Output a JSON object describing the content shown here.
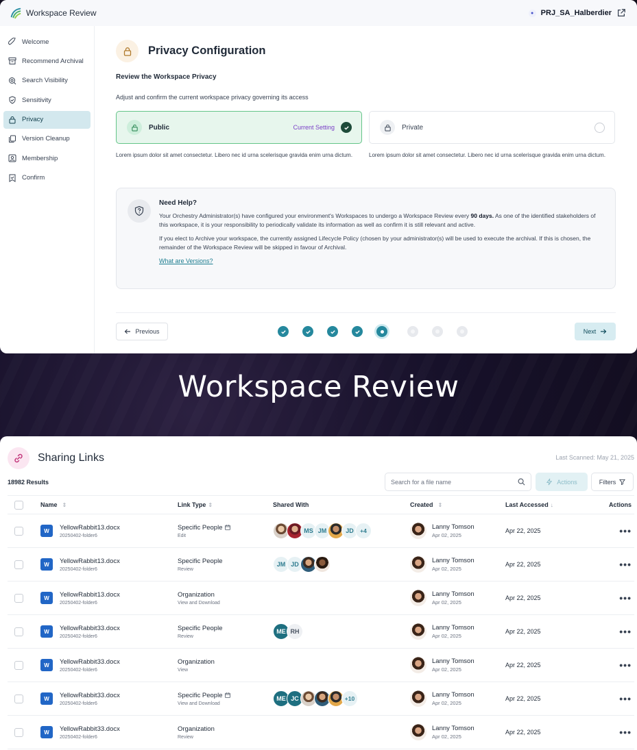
{
  "top": {
    "app_title": "Workspace Review",
    "project_name": "PRJ_SA_Halberdier",
    "sidebar": [
      {
        "label": "Welcome",
        "icon": "rocket-icon"
      },
      {
        "label": "Recommend Archival",
        "icon": "archive-icon"
      },
      {
        "label": "Search Visibility",
        "icon": "search-icon"
      },
      {
        "label": "Sensitivity",
        "icon": "shield-icon"
      },
      {
        "label": "Privacy",
        "icon": "lock-icon",
        "active": true
      },
      {
        "label": "Version Cleanup",
        "icon": "copy-icon"
      },
      {
        "label": "Membership",
        "icon": "user-icon"
      },
      {
        "label": "Confirm",
        "icon": "bookmark-check-icon"
      }
    ],
    "page_title": "Privacy Configuration",
    "subheading": "Review the Workspace Privacy",
    "description": "Adjust and confirm the current workspace privacy governing its access",
    "options": {
      "public": {
        "label": "Public",
        "current_label": "Current Setting",
        "description": "Lorem ipsum dolor sit amet consectetur. Libero nec id urna scelerisque gravida enim urna dictum.",
        "selected": true
      },
      "private": {
        "label": "Private",
        "description": "Lorem ipsum dolor sit amet consectetur. Libero nec id urna scelerisque gravida enim urna dictum.",
        "selected": false
      }
    },
    "help": {
      "title": "Need Help?",
      "p1_before": "Your Orchestry Administrator(s) have configured your environment's Workspaces to undergo a Workspace Review every ",
      "p1_bold": "90 days.",
      "p1_after": " As one of the identified stakeholders of this workspace, it is your responsibility to periodically validate its information as well as confirm it is still relevant and active.",
      "p2": "If you elect to Archive your workspace, the currently assigned Lifecycle Policy (chosen by your administrator(s) will be used to execute the archival. If this is chosen, the remainder of the Workspace Review will be skipped in favour of Archival.",
      "link": "What are Versions?"
    },
    "nav": {
      "previous": "Previous",
      "next": "Next",
      "steps": [
        "done",
        "done",
        "done",
        "done",
        "current",
        "todo",
        "todo",
        "todo"
      ]
    }
  },
  "banner": "Workspace Review",
  "bottom": {
    "title": "Sharing Links",
    "last_scanned": "Last Scanned: May 21, 2025",
    "results": "18982 Results",
    "search_placeholder": "Search for a file name",
    "actions_label": "Actions",
    "filters_label": "Filters",
    "columns": {
      "name": "Name",
      "link_type": "Link Type",
      "shared_with": "Shared With",
      "created": "Created",
      "last_accessed": "Last Accessed",
      "actions": "Actions"
    },
    "rows": [
      {
        "file": "YellowRabbit13.docx",
        "folder": "20250402-folder6",
        "link_type": "Specific People",
        "link_icon": true,
        "permission": "Edit",
        "shared": [
          {
            "type": "photo",
            "v": "photo1"
          },
          {
            "type": "photo",
            "v": "photo2"
          },
          {
            "type": "init",
            "v": "MS"
          },
          {
            "type": "init",
            "v": "JM"
          },
          {
            "type": "photo",
            "v": "photo3"
          },
          {
            "type": "init",
            "v": "JD"
          },
          {
            "type": "more",
            "v": "+4"
          }
        ],
        "creator": "Lanny Tomson",
        "created": "Apr 02, 2025",
        "accessed": "Apr 22, 2025"
      },
      {
        "file": "YellowRabbit13.docx",
        "folder": "20250402-folder6",
        "link_type": "Specific People",
        "link_icon": false,
        "permission": "Review",
        "shared": [
          {
            "type": "init",
            "v": "JM"
          },
          {
            "type": "init",
            "v": "JD"
          },
          {
            "type": "photo",
            "v": "photo4"
          },
          {
            "type": "photo",
            "v": "photo5"
          }
        ],
        "creator": "Lanny Tomson",
        "created": "Apr 02, 2025",
        "accessed": "Apr 22, 2025"
      },
      {
        "file": "YellowRabbit13.docx",
        "folder": "20250402-folder6",
        "link_type": "Organization",
        "link_icon": false,
        "permission": "View and Download",
        "shared": [],
        "creator": "Lanny Tomson",
        "created": "Apr 02, 2025",
        "accessed": "Apr 22, 2025"
      },
      {
        "file": "YellowRabbit33.docx",
        "folder": "20250402-folder6",
        "link_type": "Specific People",
        "link_icon": false,
        "permission": "Review",
        "shared": [
          {
            "type": "init-dark",
            "v": "ME"
          },
          {
            "type": "init-grey",
            "v": "RH"
          }
        ],
        "creator": "Lanny Tomson",
        "created": "Apr 02, 2025",
        "accessed": "Apr 22, 2025"
      },
      {
        "file": "YellowRabbit33.docx",
        "folder": "20250402-folder6",
        "link_type": "Organization",
        "link_icon": false,
        "permission": "View",
        "shared": [],
        "creator": "Lanny Tomson",
        "created": "Apr 02, 2025",
        "accessed": "Apr 22, 2025"
      },
      {
        "file": "YellowRabbit33.docx",
        "folder": "20250402-folder6",
        "link_type": "Specific People",
        "link_icon": true,
        "permission": "View and Download",
        "shared": [
          {
            "type": "init-dark",
            "v": "ME"
          },
          {
            "type": "init-dark",
            "v": "JC"
          },
          {
            "type": "photo",
            "v": "photo1"
          },
          {
            "type": "photo",
            "v": "photo4"
          },
          {
            "type": "photo",
            "v": "photo3"
          },
          {
            "type": "more",
            "v": "+10"
          }
        ],
        "creator": "Lanny Tomson",
        "created": "Apr 02, 2025",
        "accessed": "Apr 22, 2025"
      },
      {
        "file": "YellowRabbit33.docx",
        "folder": "20250402-folder6",
        "link_type": "Organization",
        "link_icon": false,
        "permission": "Review",
        "shared": [],
        "creator": "Lanny Tomson",
        "created": "Apr 02, 2025",
        "accessed": "Apr 22, 2025"
      }
    ]
  }
}
